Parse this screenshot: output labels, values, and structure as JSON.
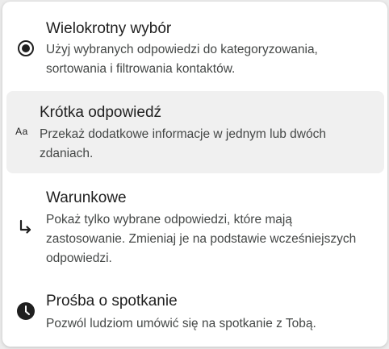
{
  "menu": {
    "items": [
      {
        "title": "Wielokrotny wybór",
        "description": "Użyj wybranych odpowiedzi do kategoryzowania, sortowania i filtrowania kontaktów.",
        "icon": "radio-button-checked-icon"
      },
      {
        "title": "Krótka odpowiedź",
        "description": "Przekaż dodatkowe informacje w jednym lub dwóch zdaniach.",
        "icon": "short-text-icon",
        "icon_text": "Aa",
        "selected": true
      },
      {
        "title": "Warunkowe",
        "description": "Pokaż tylko wybrane odpowiedzi, które mają zastosowanie. Zmieniaj je na podstawie wcześniejszych odpowiedzi.",
        "icon": "subdirectory-arrow-right-icon"
      },
      {
        "title": "Prośba o spotkanie",
        "description": "Pozwól ludziom umówić się na spotkanie z Tobą.",
        "icon": "clock-icon"
      }
    ]
  },
  "colors": {
    "text_primary": "#1f1f1f",
    "text_secondary": "#444746",
    "selected_background": "#f0f0f0",
    "surface": "#ffffff"
  }
}
